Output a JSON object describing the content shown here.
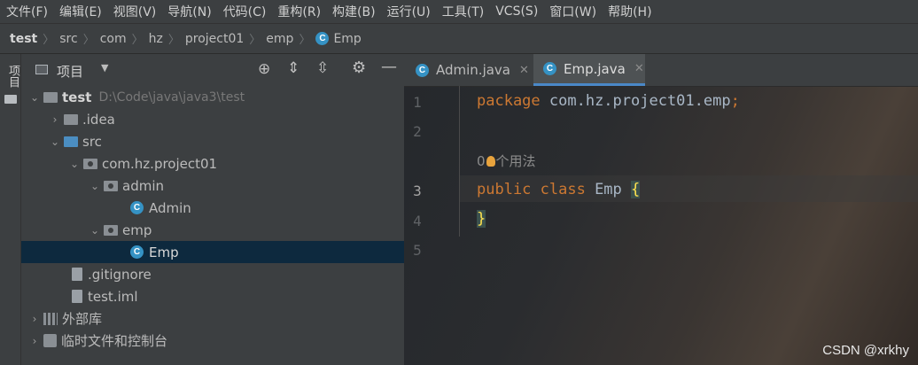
{
  "menu": {
    "items": [
      "文件(F)",
      "编辑(E)",
      "视图(V)",
      "导航(N)",
      "代码(C)",
      "重构(R)",
      "构建(B)",
      "运行(U)",
      "工具(T)",
      "VCS(S)",
      "窗口(W)",
      "帮助(H)"
    ]
  },
  "breadcrumb": {
    "items": [
      "test",
      "src",
      "com",
      "hz",
      "project01",
      "emp",
      "Emp"
    ]
  },
  "stripe": {
    "label": "项目"
  },
  "project": {
    "header": "项目",
    "tree": [
      {
        "label": "test",
        "path": "D:\\Code\\java\\java3\\test"
      },
      {
        "label": ".idea"
      },
      {
        "label": "src"
      },
      {
        "label": "com.hz.project01"
      },
      {
        "label": "admin"
      },
      {
        "label": "Admin"
      },
      {
        "label": "emp"
      },
      {
        "label": "Emp"
      },
      {
        "label": ".gitignore"
      },
      {
        "label": "test.iml"
      },
      {
        "label": "外部库"
      },
      {
        "label": "临时文件和控制台"
      }
    ]
  },
  "tabs": [
    {
      "label": "Admin.java"
    },
    {
      "label": "Emp.java"
    }
  ],
  "editor": {
    "lines": [
      "1",
      "2",
      "3",
      "4",
      "5"
    ],
    "line1_kw": "package",
    "line1_rest": " com.hz.project01.emp",
    "line1_semi": ";",
    "hint_count": "0",
    "hint_text": "个用法",
    "line3_kw": "public class",
    "line3_name": " Emp ",
    "line3_brace": "{",
    "line4_brace": "}"
  },
  "watermark": "CSDN @xrkhy",
  "colors": {
    "accent": "#4a88c7",
    "keyword": "#cc7832",
    "brace": "#ffe34f",
    "selection": "#0d293e"
  }
}
